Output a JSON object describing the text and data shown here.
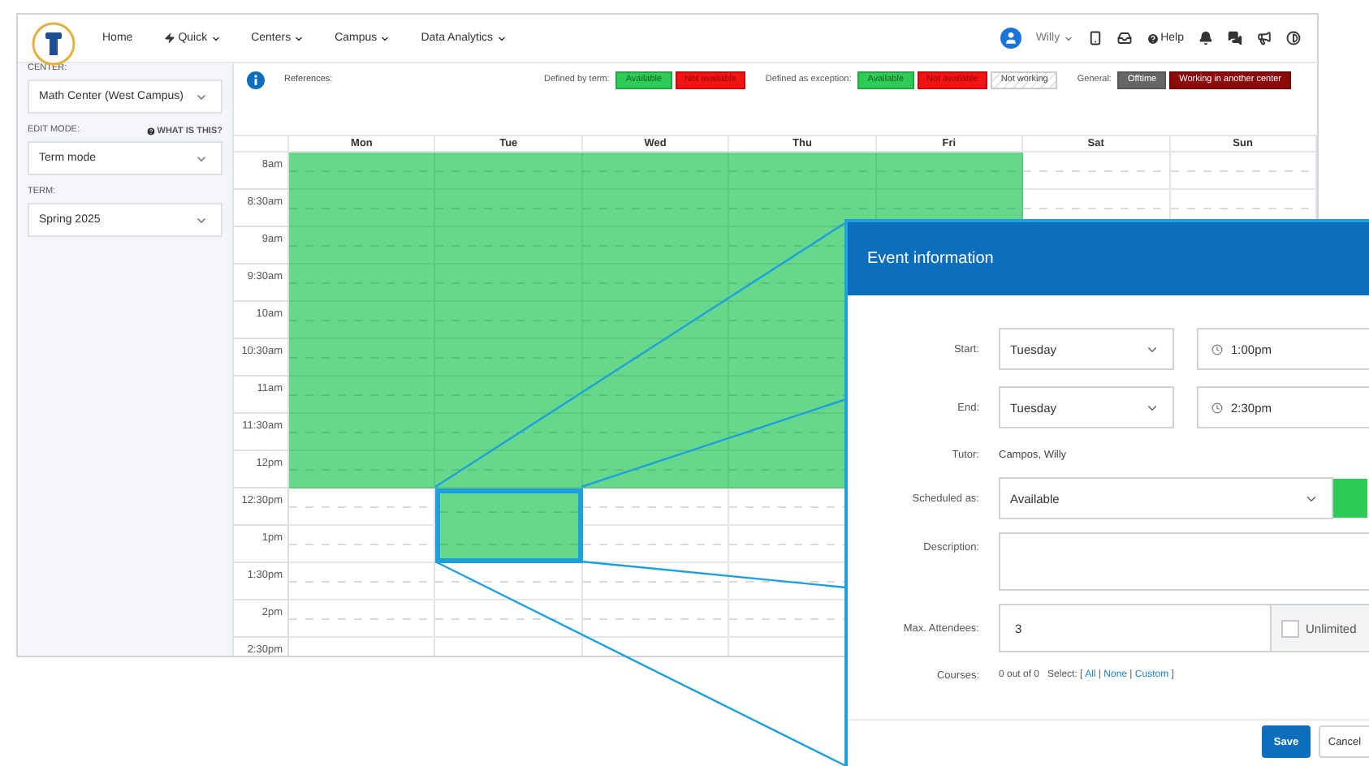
{
  "nav": {
    "items": [
      {
        "label": "Home",
        "kind": "link"
      },
      {
        "label": "Quick",
        "kind": "action-menu"
      },
      {
        "label": "Centers",
        "kind": "menu"
      },
      {
        "label": "Campus",
        "kind": "menu"
      },
      {
        "label": "Data Analytics",
        "kind": "menu"
      }
    ],
    "user": {
      "name": "Willy"
    },
    "help": "Help"
  },
  "sidebar": {
    "fields": [
      {
        "label": "CENTER:",
        "value": "Math Center (West Campus)"
      },
      {
        "label": "EDIT MODE:",
        "hint": "WHAT IS THIS?",
        "value": "Term mode"
      },
      {
        "label": "TERM:",
        "value": "Spring 2025"
      }
    ]
  },
  "legend": {
    "title": "References:",
    "groups": [
      {
        "label": "Defined by term:",
        "badges": [
          {
            "label": "Available",
            "kind": "available"
          },
          {
            "label": "Not available",
            "kind": "unavailable"
          }
        ]
      },
      {
        "label": "Defined as exception:",
        "badges": [
          {
            "label": "Available",
            "kind": "available"
          },
          {
            "label": "Not available",
            "kind": "unavailable"
          },
          {
            "label": "Not working",
            "kind": "not-working"
          }
        ]
      },
      {
        "label": "General:",
        "badges": [
          {
            "label": "Offtime",
            "kind": "offtime"
          },
          {
            "label": "Working in another center",
            "kind": "other-center"
          }
        ]
      }
    ]
  },
  "calendar": {
    "days": [
      "Mon",
      "Tue",
      "Wed",
      "Thu",
      "Fri",
      "Sat",
      "Sun"
    ],
    "rows": [
      {
        "time": "8am",
        "slots": [
          {
            "available": true,
            "selected": false
          },
          {
            "available": true,
            "selected": false
          },
          {
            "available": true,
            "selected": false
          },
          {
            "available": true,
            "selected": false
          },
          {
            "available": true,
            "selected": false
          },
          {
            "available": false,
            "selected": false
          },
          {
            "available": false,
            "selected": false
          }
        ]
      },
      {
        "time": "8:30am",
        "slots": [
          {
            "available": true,
            "selected": false
          },
          {
            "available": true,
            "selected": false
          },
          {
            "available": true,
            "selected": false
          },
          {
            "available": true,
            "selected": false
          },
          {
            "available": true,
            "selected": false
          },
          {
            "available": false,
            "selected": false
          },
          {
            "available": false,
            "selected": false
          }
        ]
      },
      {
        "time": "9am",
        "slots": [
          {
            "available": true,
            "selected": false
          },
          {
            "available": true,
            "selected": false
          },
          {
            "available": true,
            "selected": false
          },
          {
            "available": true,
            "selected": false
          }
        ]
      },
      {
        "time": "9:30am",
        "slots": [
          {
            "available": true,
            "selected": false
          },
          {
            "available": true,
            "selected": false
          },
          {
            "available": true,
            "selected": false
          },
          {
            "available": true,
            "selected": false
          }
        ]
      },
      {
        "time": "10am",
        "slots": [
          {
            "available": true,
            "selected": false
          },
          {
            "available": true,
            "selected": false
          },
          {
            "available": true,
            "selected": false
          },
          {
            "available": true,
            "selected": false
          }
        ]
      },
      {
        "time": "10:30am",
        "slots": [
          {
            "available": true,
            "selected": false
          },
          {
            "available": true,
            "selected": false
          },
          {
            "available": true,
            "selected": false
          },
          {
            "available": true,
            "selected": false
          }
        ]
      },
      {
        "time": "11am",
        "slots": [
          {
            "available": true,
            "selected": false
          },
          {
            "available": true,
            "selected": false
          },
          {
            "available": true,
            "selected": false
          },
          {
            "available": true,
            "selected": false
          }
        ]
      },
      {
        "time": "11:30am",
        "slots": [
          {
            "available": true,
            "selected": false
          },
          {
            "available": true,
            "selected": false
          },
          {
            "available": true,
            "selected": false
          },
          {
            "available": true,
            "selected": false
          }
        ]
      },
      {
        "time": "12pm",
        "slots": [
          {
            "available": true,
            "selected": false
          },
          {
            "available": true,
            "selected": false
          },
          {
            "available": true,
            "selected": false
          },
          {
            "available": true,
            "selected": false
          }
        ]
      },
      {
        "time": "12:30pm",
        "slots": [
          {
            "available": false,
            "selected": false
          },
          {
            "available": true,
            "selected": true
          },
          {
            "available": false,
            "selected": false
          },
          {
            "available": false,
            "selected": false
          }
        ]
      },
      {
        "time": "1pm",
        "slots": [
          {
            "available": false,
            "selected": false
          },
          {
            "available": true,
            "selected": true
          },
          {
            "available": false,
            "selected": false
          },
          {
            "available": false,
            "selected": false
          }
        ]
      },
      {
        "time": "1:30pm",
        "slots": [
          {
            "available": false,
            "selected": false
          },
          {
            "available": false,
            "selected": false
          },
          {
            "available": false,
            "selected": false
          },
          {
            "available": false,
            "selected": false
          }
        ]
      },
      {
        "time": "2pm",
        "slots": [
          {
            "available": false,
            "selected": false
          },
          {
            "available": false,
            "selected": false
          },
          {
            "available": false,
            "selected": false
          },
          {
            "available": false,
            "selected": false
          }
        ]
      },
      {
        "time": "2:30pm"
      }
    ]
  },
  "dialog": {
    "title": "Event information",
    "start": {
      "label": "Start:",
      "day": "Tuesday",
      "time": "1:00pm"
    },
    "end": {
      "label": "End:",
      "day": "Tuesday",
      "time": "2:30pm"
    },
    "tutor": {
      "label": "Tutor:",
      "value": "Campos, Willy"
    },
    "scheduled": {
      "label": "Scheduled as:",
      "value": "Available"
    },
    "description": {
      "label": "Description:"
    },
    "attendees": {
      "label": "Max. Attendees:",
      "value": "3",
      "unlimited": {
        "label": "Unlimited",
        "checked": false
      }
    },
    "courses": {
      "label": "Courses:",
      "summary": "0 out of 0",
      "select_prefix": "Select: [",
      "links": [
        "All",
        "None",
        "Custom"
      ],
      "separator": "|",
      "select_suffix": "]"
    },
    "buttons": {
      "save": "Save",
      "cancel": "Cancel"
    }
  }
}
